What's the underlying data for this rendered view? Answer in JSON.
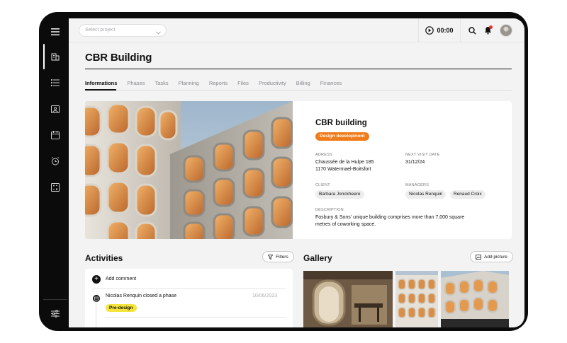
{
  "topbar": {
    "project_placeholder": "Select project",
    "timer": "00:00"
  },
  "sidebar": {
    "items": [
      "building-icon",
      "list-icon",
      "image-icon",
      "calendar-icon",
      "alarm-icon",
      "calculator-icon"
    ],
    "bottom": "sliders-icon"
  },
  "page": {
    "title": "CBR Building"
  },
  "tabs": [
    "Informations",
    "Phases",
    "Tasks",
    "Planning",
    "Reports",
    "Files",
    "Productivity",
    "Billing",
    "Finances"
  ],
  "project": {
    "name": "CBR building",
    "status": "Design development",
    "address_label": "ADRESS",
    "address_line1": "Chaussée de la Hulpe 185",
    "address_line2": "1170 Watermael-Boitsfort",
    "next_visit_label": "NEXT VISIT DATE",
    "next_visit": "31/12/24",
    "client_label": "CLIENT",
    "client": "Barbara Jonckheere",
    "managers_label": "MANAGERS",
    "managers": [
      "Nicolas Renquin",
      "Renaud Croix"
    ],
    "description_label": "DESCRIPTION",
    "description_line1": "Fosbury & Sons' unique building comprises more than 7,000 square",
    "description_line2": "metres of coworking space."
  },
  "activities": {
    "title": "Activities",
    "filters_label": "Filters",
    "add_comment": "Add comment",
    "item_text": "Nicolas Renquin closed a phase",
    "item_date": "10/06/2023",
    "item_badge": "Pre-design"
  },
  "gallery": {
    "title": "Gallery",
    "add_label": "Add picture"
  },
  "colors": {
    "accent_orange": "#f07b1a",
    "accent_yellow": "#f4e43c",
    "notification": "#e8312a"
  }
}
